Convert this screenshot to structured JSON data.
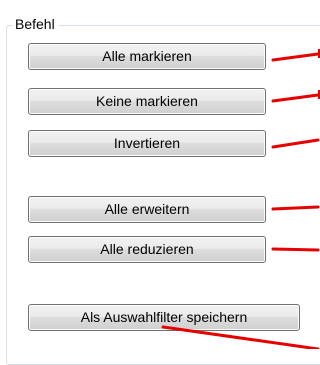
{
  "group": {
    "title": "Befehl"
  },
  "buttons": [
    {
      "label": "Alle markieren"
    },
    {
      "label": "Keine markieren"
    },
    {
      "label": "Invertieren"
    },
    {
      "label": "Alle erweitern"
    },
    {
      "label": "Alle reduzieren"
    },
    {
      "label": "Als Auswahlfilter speichern"
    }
  ],
  "colors": {
    "annotation_arrow": "#e60000",
    "button_border": "#707070",
    "group_border": "#d5dfe5"
  }
}
